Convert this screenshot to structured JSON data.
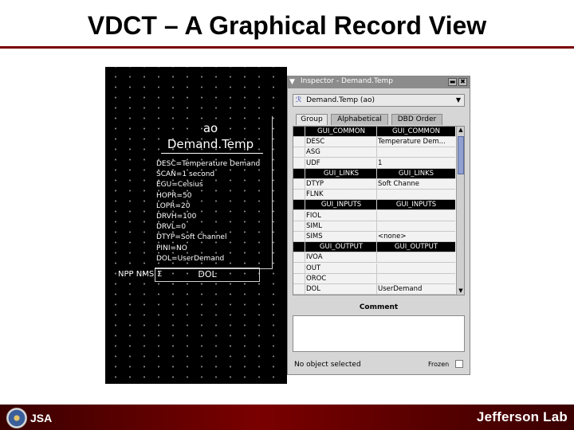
{
  "slide": {
    "title": "VDCT – A Graphical Record View"
  },
  "canvas": {
    "record": {
      "type": "ao",
      "name": "Demand.Temp",
      "fields": [
        "DESC=Temperature Demand",
        "SCAN=1 second",
        "EGU=Celsius",
        "HOPR=50",
        "LOPR=20",
        "DRVH=100",
        "DRVL=0",
        "DTYP=Soft Channel",
        "PINI=NO",
        "DOL=UserDemand"
      ]
    },
    "link": {
      "label": "NPP NMS",
      "symbol": "Σ",
      "field": "DOL"
    }
  },
  "inspector": {
    "title": "Inspector - Demand.Temp",
    "min_glyph": "▬",
    "close_glyph": "✖",
    "record_selector": {
      "icon_glyph": "ℛ",
      "value": "Demand.Temp (ao)"
    },
    "tabs": [
      {
        "label": "Group",
        "active": true
      },
      {
        "label": "Alphabetical",
        "active": false
      },
      {
        "label": "DBD Order",
        "active": false
      }
    ],
    "properties": [
      {
        "name": "GUI_COMMON",
        "value": "GUI_COMMON",
        "group": true
      },
      {
        "name": "DESC",
        "value": "Temperature Dem...",
        "group": false
      },
      {
        "name": "ASG",
        "value": "",
        "group": false
      },
      {
        "name": "UDF",
        "value": "1",
        "group": false
      },
      {
        "name": "GUI_LINKS",
        "value": "GUI_LINKS",
        "group": true
      },
      {
        "name": "DTYP",
        "value": "Soft Channe",
        "group": false
      },
      {
        "name": "FLNK",
        "value": "",
        "group": false
      },
      {
        "name": "GUI_INPUTS",
        "value": "GUI_INPUTS",
        "group": true
      },
      {
        "name": "FIOL",
        "value": "",
        "group": false
      },
      {
        "name": "SIML",
        "value": "",
        "group": false
      },
      {
        "name": "SIMS",
        "value": "<none>",
        "group": false
      },
      {
        "name": "GUI_OUTPUT",
        "value": "GUI_OUTPUT",
        "group": true
      },
      {
        "name": "IVOA",
        "value": "",
        "group": false
      },
      {
        "name": "OUT",
        "value": "",
        "group": false
      },
      {
        "name": "OROC",
        "value": "",
        "group": false
      },
      {
        "name": "DOL",
        "value": "UserDemand",
        "group": false
      }
    ],
    "comment_label": "Comment",
    "comment_value": "",
    "status": "No object selected",
    "frozen_label": "Frozen"
  },
  "footer": {
    "jsa_text": "JSA",
    "brand": "Jefferson Lab"
  },
  "colors": {
    "title_rule": "#7a0000",
    "footer": "#7a0000",
    "group_row": "#000000",
    "scroll_thumb": "#8f9fd0"
  }
}
